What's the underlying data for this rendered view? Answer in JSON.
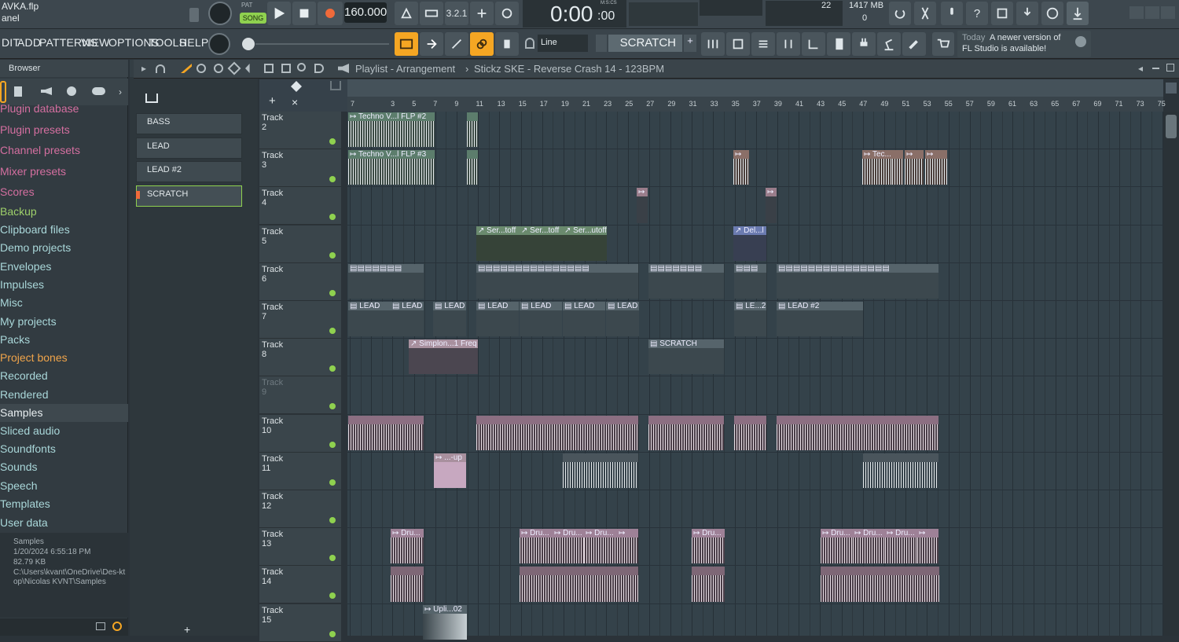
{
  "window": {
    "file_title": "AVKA.flp",
    "panel_label": "anel"
  },
  "transport": {
    "pat_label": "PAT",
    "song_label": "SONG",
    "tempo": "160.000",
    "time": "0:00",
    "time_small": ":00",
    "time_label": "M:S:CS"
  },
  "cpu": {
    "value": "22",
    "memory": "1417 MB",
    "zero": "0"
  },
  "menu": [
    "DIT",
    "ADD",
    "PATTERNS",
    "VIEW",
    "OPTIONS",
    "TOOLS",
    "HELP"
  ],
  "toolbar": {
    "snap_mode": "Line",
    "pattern_name": "SCRATCH",
    "plus": "+"
  },
  "hint": {
    "line1_prefix": "Today",
    "line1": "A newer version of",
    "line2": "FL Studio is available!"
  },
  "browser": {
    "title": "Browser",
    "items": [
      "Plugin database",
      "Plugin presets",
      "Channel presets",
      "Mixer presets",
      "Scores",
      "Backup",
      "Clipboard files",
      "Demo projects",
      "Envelopes",
      "Impulses",
      "Misc",
      "My projects",
      "Packs",
      "Project bones",
      "Recorded",
      "Rendered",
      "Samples",
      "Sliced audio",
      "Soundfonts",
      "Sounds",
      "Speech",
      "Templates",
      "User data"
    ],
    "selected": "Samples",
    "info": {
      "name": "Samples",
      "date": "1/20/2024 6:55:18 PM",
      "size": "82.79 KB",
      "path": "C:\\Users\\kvant\\OneDrive\\Des-ktop\\Nicolas KVNT\\Samples"
    }
  },
  "channels": [
    "BASS",
    "LEAD",
    "LEAD #2",
    "SCRATCH"
  ],
  "playlist": {
    "title": "Playlist - Arrangement",
    "sep": "›",
    "sample": "Stickz SKE - Reverse Crash 14 - 123BPM",
    "bars": [
      "7",
      "3",
      "5",
      "7",
      "9",
      "11",
      "13",
      "15",
      "17",
      "19",
      "21",
      "23",
      "25",
      "27",
      "29",
      "31",
      "33",
      "35",
      "37",
      "39",
      "41",
      "43",
      "45",
      "47",
      "49",
      "51",
      "53",
      "55",
      "57",
      "59",
      "61",
      "63",
      "65",
      "67",
      "69",
      "71",
      "73",
      "75"
    ],
    "tracks": [
      "Track 2",
      "Track 3",
      "Track 4",
      "Track 5",
      "Track 6",
      "Track 7",
      "Track 8",
      "Track 9",
      "Track 10",
      "Track 11",
      "Track 12",
      "Track 13",
      "Track 14",
      "Track 15"
    ],
    "clip_labels": {
      "t2a": "Techno V...l FLP #2",
      "t3a": "Techno V...l FLP #3",
      "t3b": "Tec...",
      "t5a": "Ser...toff",
      "t5b": "Ser...toff",
      "t5c": "Ser...utoff",
      "t5d": "Del...l",
      "t7": "LEAD",
      "t7b": "LE...2",
      "t7c": "LEAD #2",
      "t8a": "Simplon...1 Freq",
      "t8b": "SCRATCH",
      "t11": "...-up",
      "t13": "Dru...",
      "t15": "Upli...02"
    }
  },
  "colors": {
    "accent": "#f5a623",
    "led": "#8fd14f",
    "clip_green": "#5c7d6c",
    "clip_pink": "#a8909e",
    "clip_brown": "#8a6f68"
  }
}
